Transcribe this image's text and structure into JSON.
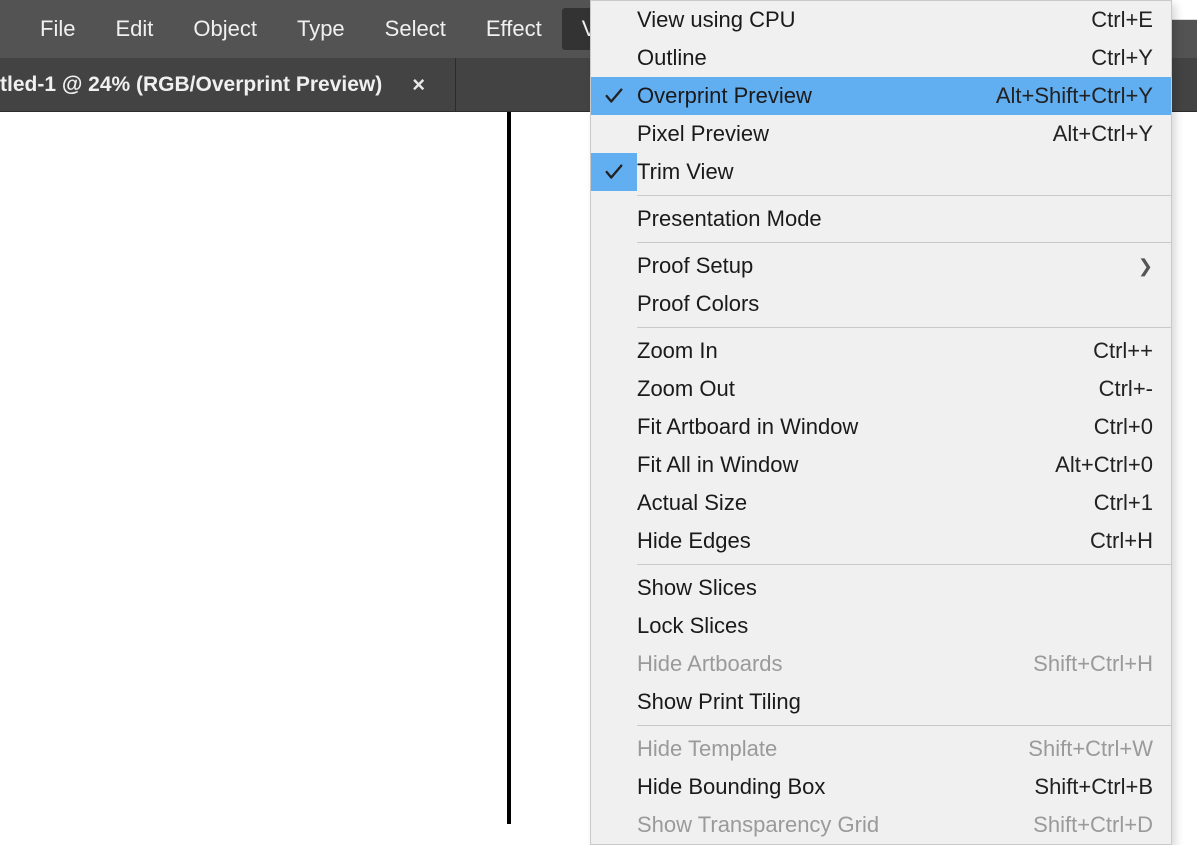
{
  "menubar": {
    "items": [
      {
        "label": "File"
      },
      {
        "label": "Edit"
      },
      {
        "label": "Object"
      },
      {
        "label": "Type"
      },
      {
        "label": "Select"
      },
      {
        "label": "Effect"
      },
      {
        "label": "View"
      }
    ]
  },
  "tab": {
    "title": "tled-1 @ 24% (RGB/Overprint Preview)"
  },
  "view_menu": {
    "groups": [
      [
        {
          "label": "View using CPU",
          "shortcut": "Ctrl+E",
          "checked": false,
          "disabled": false,
          "submenu": false,
          "selected": false
        },
        {
          "label": "Outline",
          "shortcut": "Ctrl+Y",
          "checked": false,
          "disabled": false,
          "submenu": false,
          "selected": false
        },
        {
          "label": "Overprint Preview",
          "shortcut": "Alt+Shift+Ctrl+Y",
          "checked": true,
          "disabled": false,
          "submenu": false,
          "selected": true
        },
        {
          "label": "Pixel Preview",
          "shortcut": "Alt+Ctrl+Y",
          "checked": false,
          "disabled": false,
          "submenu": false,
          "selected": false
        },
        {
          "label": "Trim View",
          "shortcut": "",
          "checked": true,
          "disabled": false,
          "submenu": false,
          "selected": false
        }
      ],
      [
        {
          "label": "Presentation Mode",
          "shortcut": "",
          "checked": false,
          "disabled": false,
          "submenu": false,
          "selected": false
        }
      ],
      [
        {
          "label": "Proof Setup",
          "shortcut": "",
          "checked": false,
          "disabled": false,
          "submenu": true,
          "selected": false
        },
        {
          "label": "Proof Colors",
          "shortcut": "",
          "checked": false,
          "disabled": false,
          "submenu": false,
          "selected": false
        }
      ],
      [
        {
          "label": "Zoom In",
          "shortcut": "Ctrl++",
          "checked": false,
          "disabled": false,
          "submenu": false,
          "selected": false
        },
        {
          "label": "Zoom Out",
          "shortcut": "Ctrl+-",
          "checked": false,
          "disabled": false,
          "submenu": false,
          "selected": false
        },
        {
          "label": "Fit Artboard in Window",
          "shortcut": "Ctrl+0",
          "checked": false,
          "disabled": false,
          "submenu": false,
          "selected": false
        },
        {
          "label": "Fit All in Window",
          "shortcut": "Alt+Ctrl+0",
          "checked": false,
          "disabled": false,
          "submenu": false,
          "selected": false
        },
        {
          "label": "Actual Size",
          "shortcut": "Ctrl+1",
          "checked": false,
          "disabled": false,
          "submenu": false,
          "selected": false
        },
        {
          "label": "Hide Edges",
          "shortcut": "Ctrl+H",
          "checked": false,
          "disabled": false,
          "submenu": false,
          "selected": false
        }
      ],
      [
        {
          "label": "Show Slices",
          "shortcut": "",
          "checked": false,
          "disabled": false,
          "submenu": false,
          "selected": false
        },
        {
          "label": "Lock Slices",
          "shortcut": "",
          "checked": false,
          "disabled": false,
          "submenu": false,
          "selected": false
        },
        {
          "label": "Hide Artboards",
          "shortcut": "Shift+Ctrl+H",
          "checked": false,
          "disabled": true,
          "submenu": false,
          "selected": false
        },
        {
          "label": "Show Print Tiling",
          "shortcut": "",
          "checked": false,
          "disabled": false,
          "submenu": false,
          "selected": false
        }
      ],
      [
        {
          "label": "Hide Template",
          "shortcut": "Shift+Ctrl+W",
          "checked": false,
          "disabled": true,
          "submenu": false,
          "selected": false
        },
        {
          "label": "Hide Bounding Box",
          "shortcut": "Shift+Ctrl+B",
          "checked": false,
          "disabled": false,
          "submenu": false,
          "selected": false
        },
        {
          "label": "Show Transparency Grid",
          "shortcut": "Shift+Ctrl+D",
          "checked": false,
          "disabled": true,
          "submenu": false,
          "selected": false
        }
      ]
    ]
  }
}
